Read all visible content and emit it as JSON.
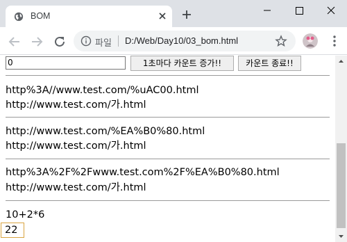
{
  "browser": {
    "tab_title": "BOM",
    "address_scheme": "파일",
    "address_url": "D:/Web/Day10/03_bom.html"
  },
  "page": {
    "counter_input_value": "0",
    "start_button_label": "1초마다 카운트 증가!!",
    "stop_button_label": "카운트 종료!!",
    "escape_encoded": "http%3A//www.test.com/%uAC00.html",
    "escape_decoded": "http://www.test.com/가.html",
    "uri_encoded": "http://www.test.com/%EA%B0%80.html",
    "uri_decoded": "http://www.test.com/가.html",
    "uri_component_encoded": "http%3A%2F%2Fwww.test.com%2F%EA%B0%80.html",
    "uri_component_decoded": "http://www.test.com/가.html",
    "eval_expression": "10+2*6",
    "eval_result": "22"
  },
  "icons": {
    "favicon": "globe-icon",
    "close": "close-icon",
    "new_tab": "plus-icon",
    "back": "back-arrow-icon",
    "forward": "forward-arrow-icon",
    "reload": "reload-icon",
    "info": "info-icon",
    "bookmark": "star-icon",
    "profile": "avatar",
    "menu": "kebab-menu-icon"
  }
}
